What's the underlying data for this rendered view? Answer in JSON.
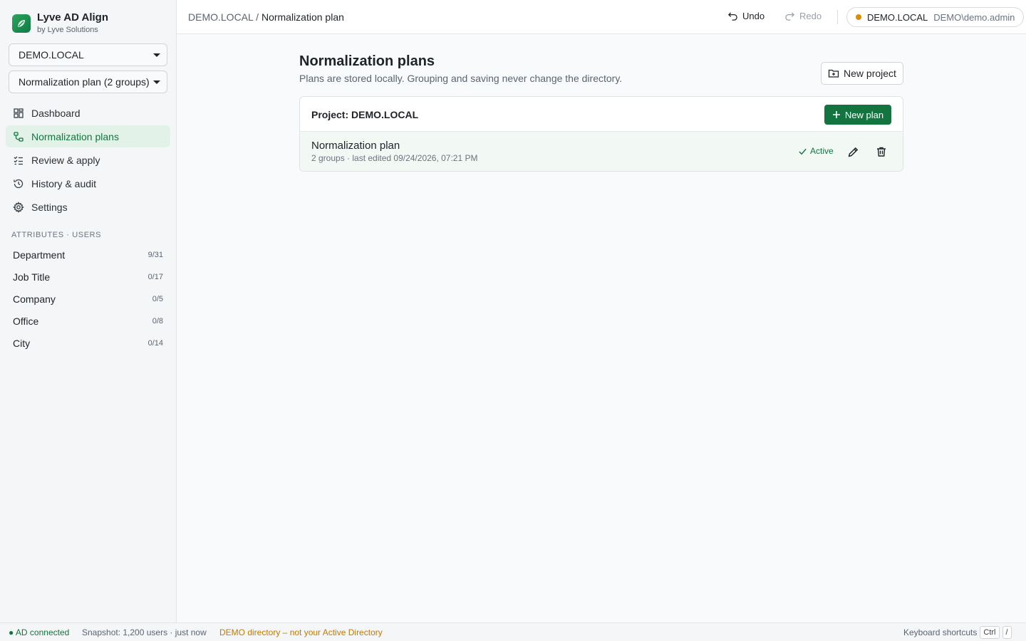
{
  "app": {
    "name": "Lyve AD Align",
    "byline": "by Lyve Solutions"
  },
  "selectors": {
    "domain": "DEMO.LOCAL",
    "plan": "Normalization plan (2 groups)"
  },
  "nav": [
    {
      "label": "Dashboard",
      "icon": "dashboard-icon"
    },
    {
      "label": "Normalization plans",
      "icon": "plans-icon"
    },
    {
      "label": "Review & apply",
      "icon": "checklist-icon"
    },
    {
      "label": "History & audit",
      "icon": "history-icon"
    },
    {
      "label": "Settings",
      "icon": "gear-icon"
    }
  ],
  "attributes": {
    "label": "ATTRIBUTES · USERS",
    "items": [
      {
        "name": "Department",
        "count": "9/31"
      },
      {
        "name": "Job Title",
        "count": "0/17"
      },
      {
        "name": "Company",
        "count": "0/5"
      },
      {
        "name": "Office",
        "count": "0/8"
      },
      {
        "name": "City",
        "count": "0/14"
      }
    ]
  },
  "topbar": {
    "crumb_root": "DEMO.LOCAL",
    "crumb_sep": "/",
    "crumb_current": "Normalization plan",
    "undo": "Undo",
    "redo": "Redo",
    "conn_domain": "DEMO.LOCAL",
    "conn_user": "DEMO\\demo.admin",
    "conn_color": "#d98e04"
  },
  "main": {
    "title": "Normalization plans",
    "subtitle": "Plans are stored locally. Grouping and saving never change the directory.",
    "new_project": "New project",
    "project": {
      "title": "Project: DEMO.LOCAL",
      "new_plan": "New plan",
      "plans": [
        {
          "name": "Normalization plan",
          "meta": "2 groups · last edited 09/24/2026, 07:21 PM",
          "status": "Active"
        }
      ]
    }
  },
  "status": {
    "connected": "● AD connected",
    "snapshot": "Snapshot: 1,200 users · just now",
    "warning": "DEMO directory – not your Active Directory",
    "shortcuts": "Keyboard shortcuts",
    "key1": "Ctrl",
    "key2": "/"
  },
  "colors": {
    "accent": "#13743f",
    "warning": "#c27a03"
  }
}
